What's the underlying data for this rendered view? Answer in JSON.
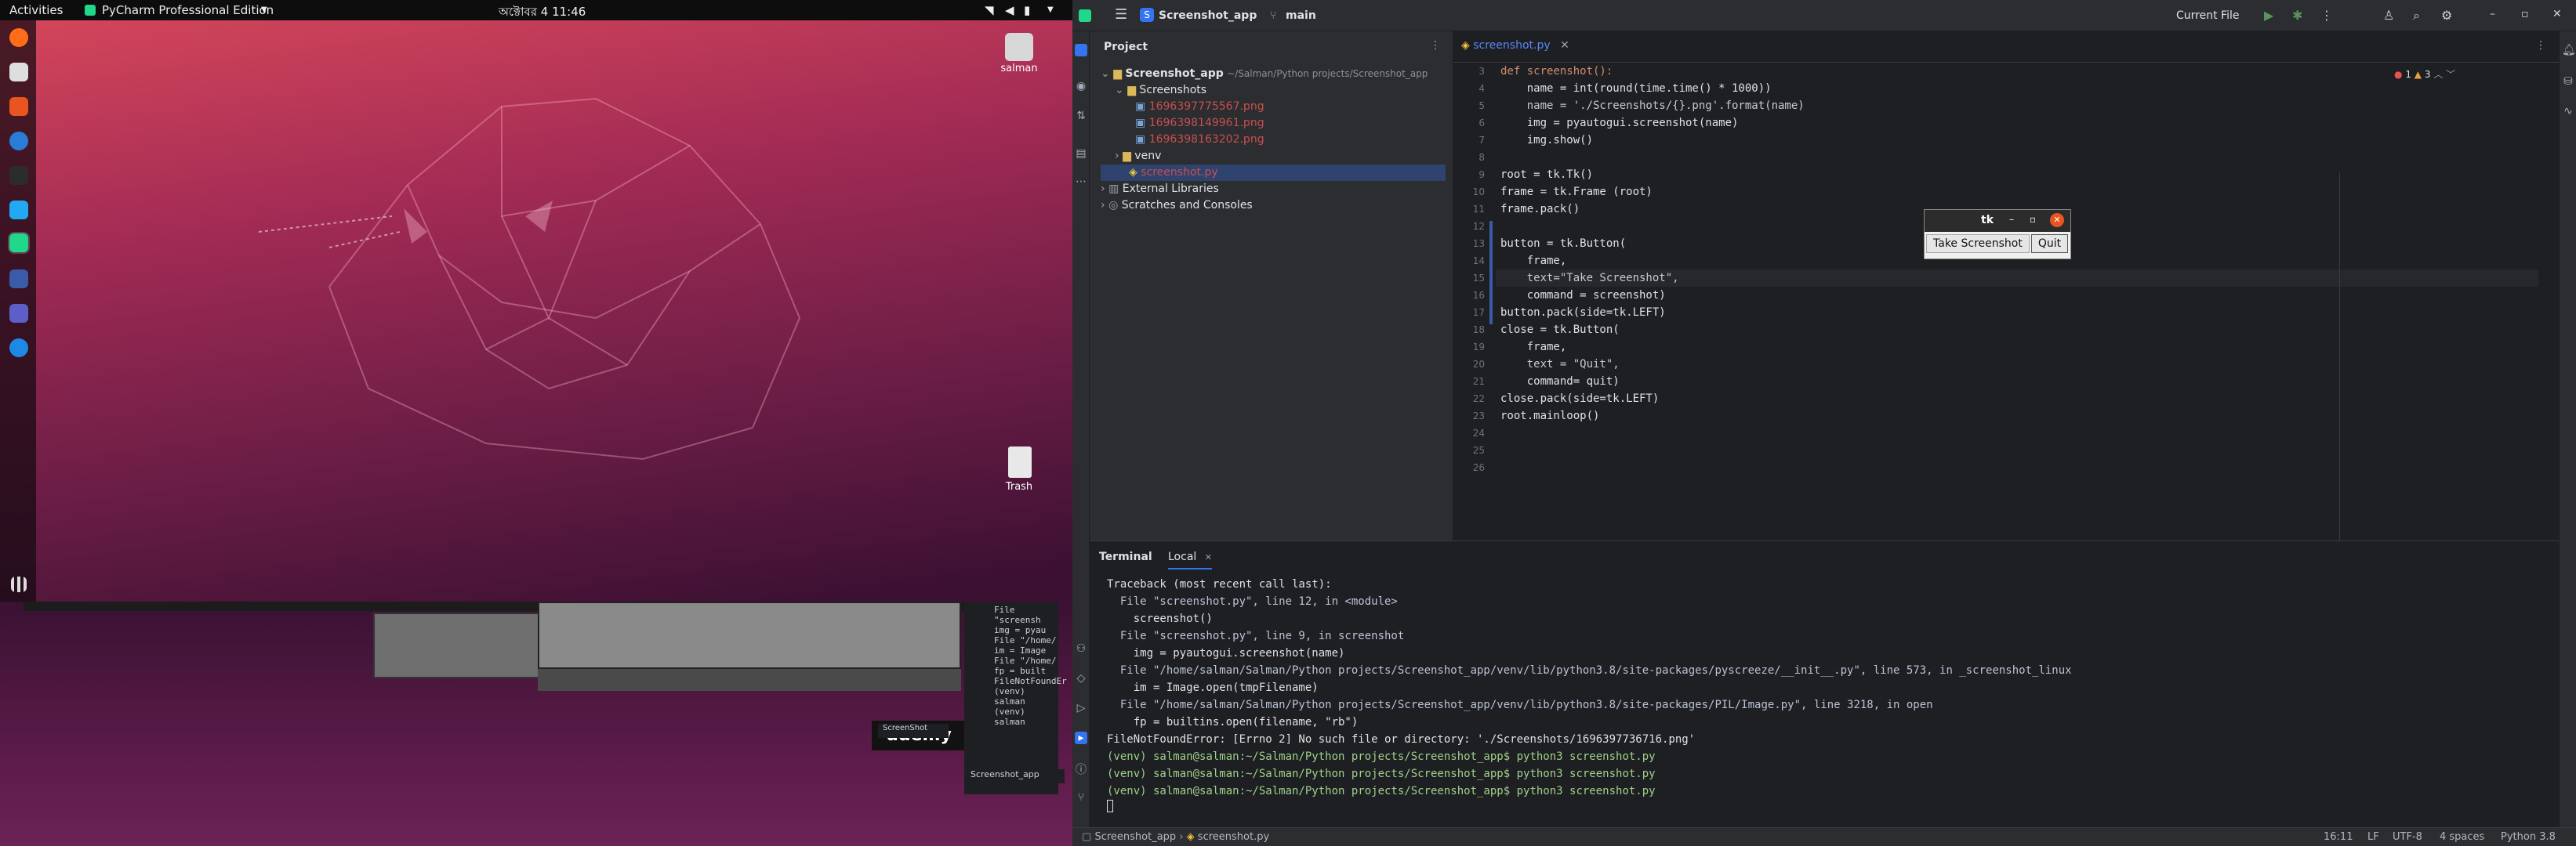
{
  "topbar": {
    "activities": "Activities",
    "app_menu": "PyCharm Professional Edition",
    "clock": "অক্টোবর 4  11:46"
  },
  "desktop": {
    "home_label": "salman",
    "trash_label": "Trash"
  },
  "colors": {
    "pycharm_bg": "#1e1f22",
    "pycharm_panel": "#2b2d30",
    "link": "#548af7",
    "ubuntu_accent": "#e95420"
  },
  "pycharm": {
    "project_name": "Screenshot_app",
    "branch": "main",
    "run_config": "Current File",
    "project_panel_title": "Project",
    "tree": {
      "root": "Screenshot_app",
      "root_path": "~/Salman/Python projects/Screenshot_app",
      "screenshots_folder": "Screenshots",
      "files": [
        "1696397775567.png",
        "1696398149961.png",
        "1696398163202.png"
      ],
      "venv": "venv",
      "script": "screenshot.py",
      "external_libraries": "External Libraries",
      "scratches": "Scratches and Consoles"
    },
    "editor_tab": "screenshot.py",
    "inspections": {
      "errors": "1",
      "warnings": "3"
    },
    "line_numbers": [
      "3",
      "4",
      "5",
      "6",
      "7",
      "8",
      "9",
      "10",
      "11",
      "12",
      "13",
      "14",
      "15",
      "16",
      "17",
      "18",
      "19",
      "20",
      "21",
      "22",
      "23",
      "24",
      "25",
      "26"
    ],
    "code_lines": [
      "def screenshot():",
      "    name = int(round(time.time() * 1000))",
      "    name = './Screenshots/{}.png'.format(name)",
      "    img = pyautogui.screenshot(name)",
      "    img.show()",
      "",
      "root = tk.Tk()",
      "frame = tk.Frame (root)",
      "frame.pack()",
      "",
      "button = tk.Button(",
      "    frame,",
      "    text=\"Take Screenshot\",",
      "    command = screenshot)",
      "button.pack(side=tk.LEFT)",
      "close = tk.Button(",
      "    frame,",
      "    text = \"Quit\",",
      "    command= quit)",
      "close.pack(side=tk.LEFT)",
      "root.mainloop()",
      "",
      "",
      ""
    ],
    "terminal": {
      "tab_title": "Terminal",
      "tab_local": "Local",
      "lines": [
        "Traceback (most recent call last):",
        "  File \"screenshot.py\", line 12, in <module>",
        "    screenshot()",
        "  File \"screenshot.py\", line 9, in screenshot",
        "    img = pyautogui.screenshot(name)",
        "  File \"/home/salman/Salman/Python projects/Screenshot_app/venv/lib/python3.8/site-packages/pyscreeze/__init__.py\", line 573, in _screenshot_linux",
        "    im = Image.open(tmpFilename)",
        "  File \"/home/salman/Salman/Python projects/Screenshot_app/venv/lib/python3.8/site-packages/PIL/Image.py\", line 3218, in open",
        "    fp = builtins.open(filename, \"rb\")",
        "FileNotFoundError: [Errno 2] No such file or directory: './Screenshots/1696397736716.png'",
        "(venv) salman@salman:~/Salman/Python projects/Screenshot_app$ python3 screenshot.py",
        "(venv) salman@salman:~/Salman/Python projects/Screenshot_app$ python3 screenshot.py",
        "(venv) salman@salman:~/Salman/Python projects/Screenshot_app$ python3 screenshot.py"
      ]
    },
    "status": {
      "breadcrumb_project": "Screenshot_app",
      "breadcrumb_file": "screenshot.py",
      "position": "16:11",
      "line_sep": "LF",
      "encoding": "UTF-8",
      "indent": "4 spaces",
      "interpreter": "Python 3.8"
    }
  },
  "tk_window": {
    "title": "tk",
    "button_take": "Take Screenshot",
    "button_quit": "Quit"
  },
  "background_fragments": {
    "lines": [
      "File \"screensh",
      "  img = pyau",
      "File \"/home/",
      "  im = Image",
      "File \"/home/",
      "  fp = built",
      "FileNotFoundEr",
      "(venv) salman",
      "(venv) salman"
    ],
    "tab1": "ScreenShot",
    "tab2": "Screenshot_app",
    "udemy": "udemy"
  }
}
